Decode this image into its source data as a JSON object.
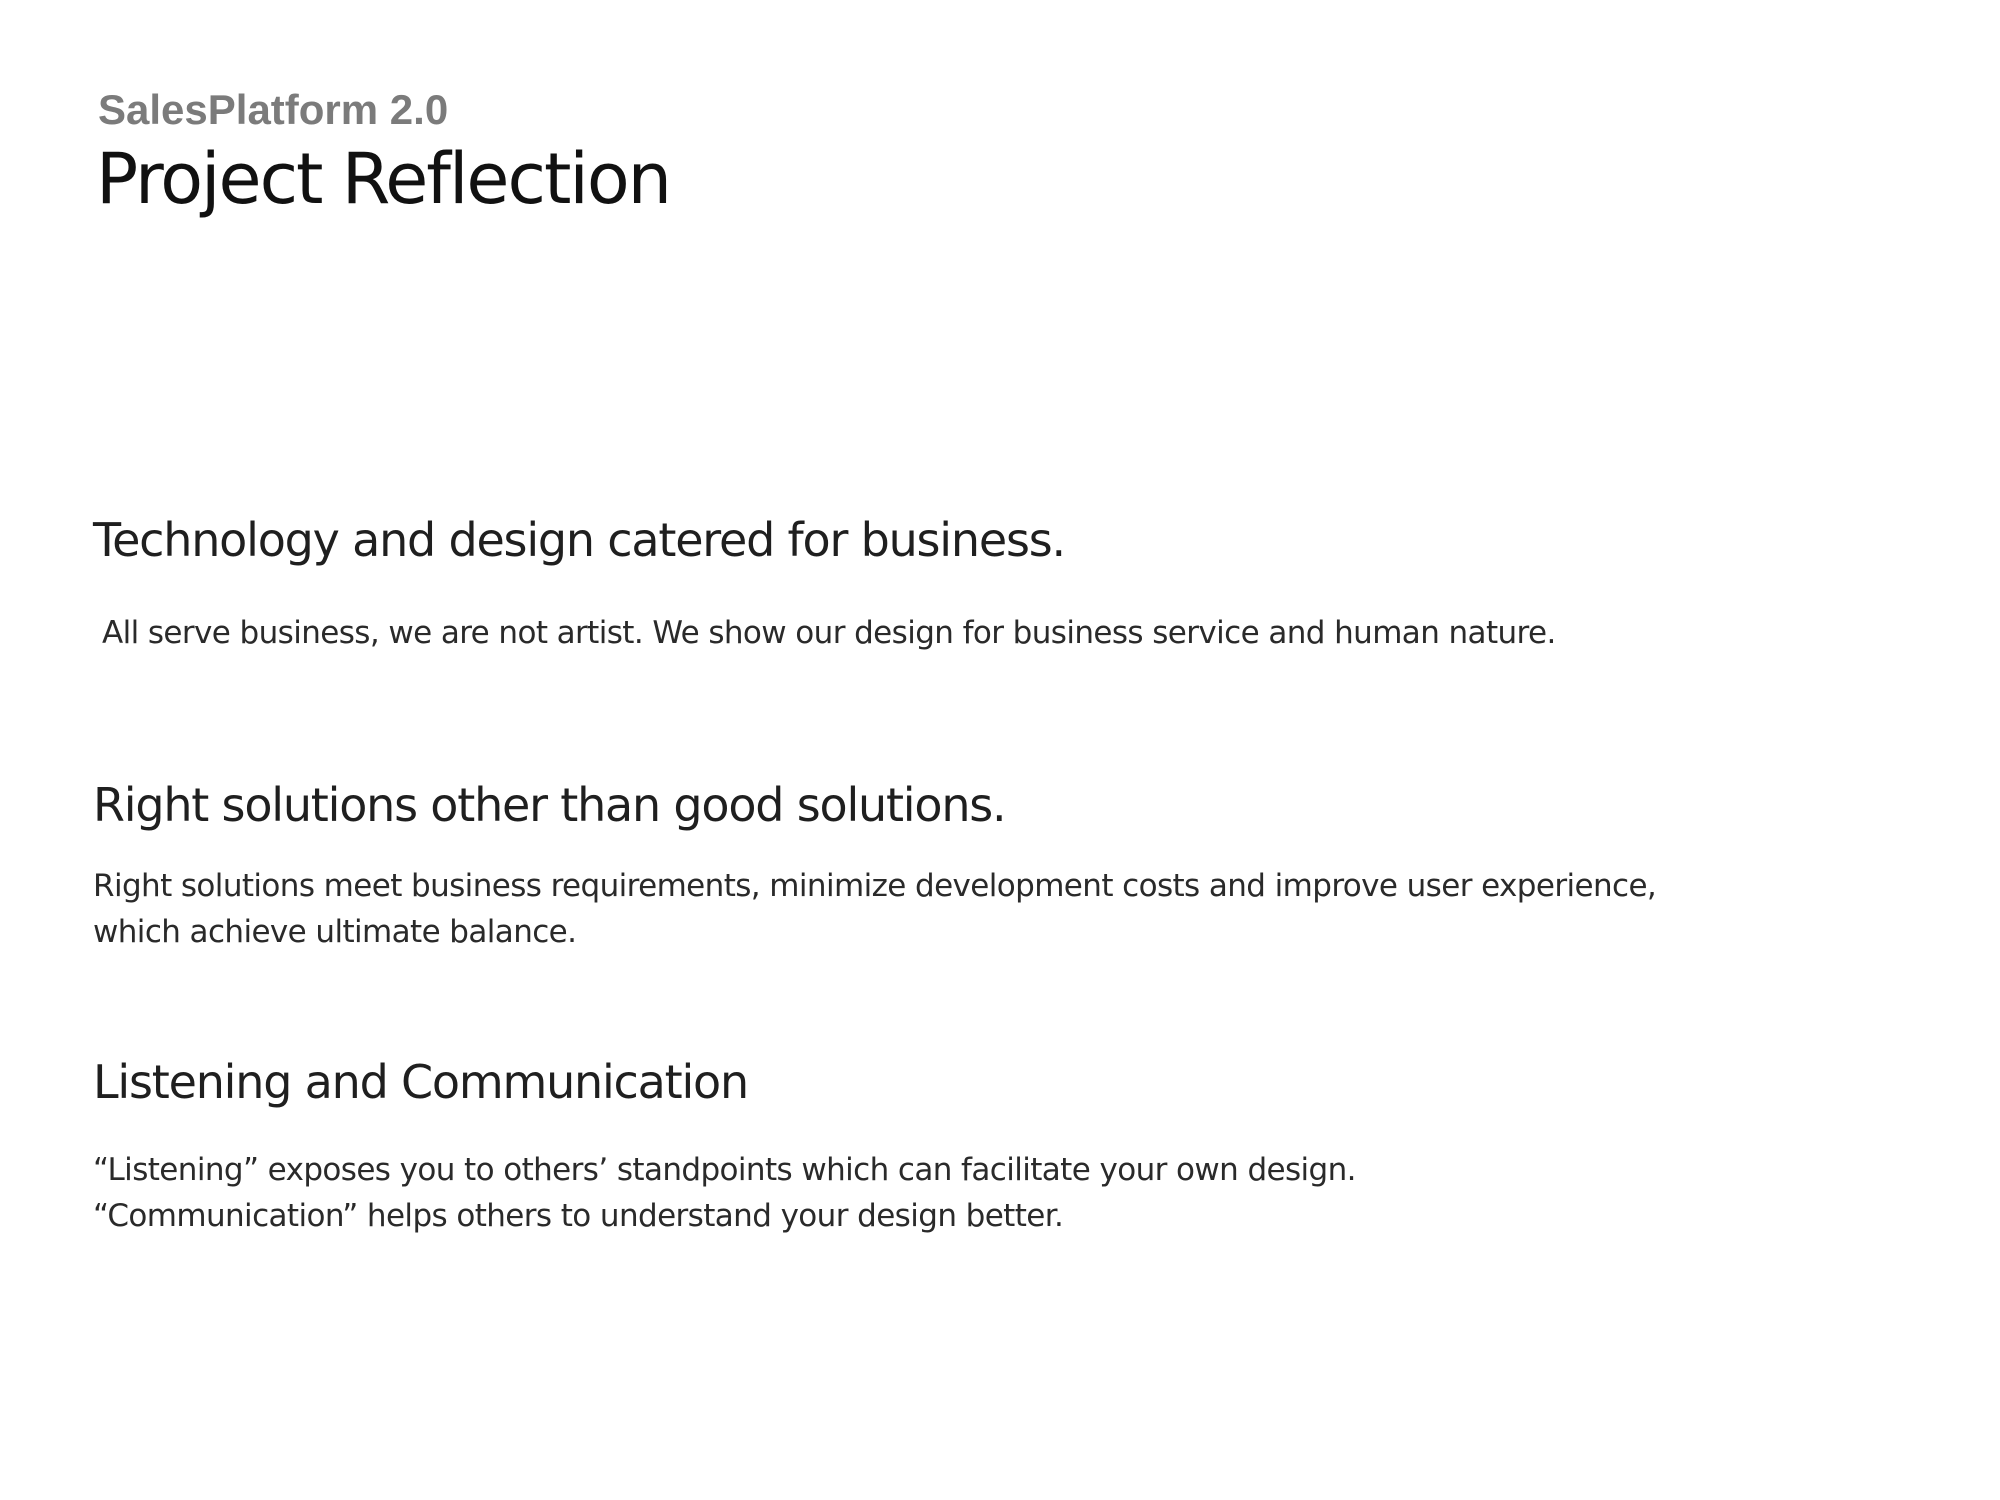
{
  "header": {
    "project_name": "SalesPlatform 2.0",
    "title": "Project Reflection"
  },
  "sections": [
    {
      "heading": "Technology and design catered for business.",
      "body": [
        "All serve business, we are not artist. We show our design for business service and human nature."
      ]
    },
    {
      "heading": "Right solutions other than good solutions.",
      "body": [
        "Right solutions meet business requirements, minimize development costs and improve user experience,",
        "which achieve ultimate balance."
      ]
    },
    {
      "heading": "Listening and Communication",
      "body": [
        "“Listening” exposes you to others’ standpoints which can facilitate your own design.",
        "“Communication” helps others to understand your design better."
      ]
    }
  ]
}
